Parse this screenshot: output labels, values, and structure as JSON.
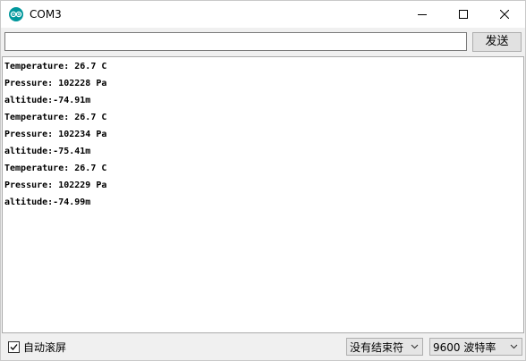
{
  "window": {
    "title": "COM3"
  },
  "send": {
    "input_value": "",
    "button_label": "发送"
  },
  "output": {
    "lines": [
      "Temperature: 26.7 C",
      "Pressure: 102228 Pa",
      "altitude:-74.91m",
      "Temperature: 26.7 C",
      "Pressure: 102234 Pa",
      "altitude:-75.41m",
      "Temperature: 26.7 C",
      "Pressure: 102229 Pa",
      "altitude:-74.99m"
    ]
  },
  "footer": {
    "autoscroll_label": "自动滚屏",
    "autoscroll_checked": true,
    "line_ending": "没有结束符",
    "baud_rate": "9600 波特率"
  },
  "icons": {
    "app": "arduino-icon",
    "minimize": "minimize-icon",
    "maximize": "maximize-icon",
    "close": "close-icon",
    "dropdown": "chevron-down-icon",
    "check": "check-icon"
  },
  "colors": {
    "accent": "#00979c"
  }
}
